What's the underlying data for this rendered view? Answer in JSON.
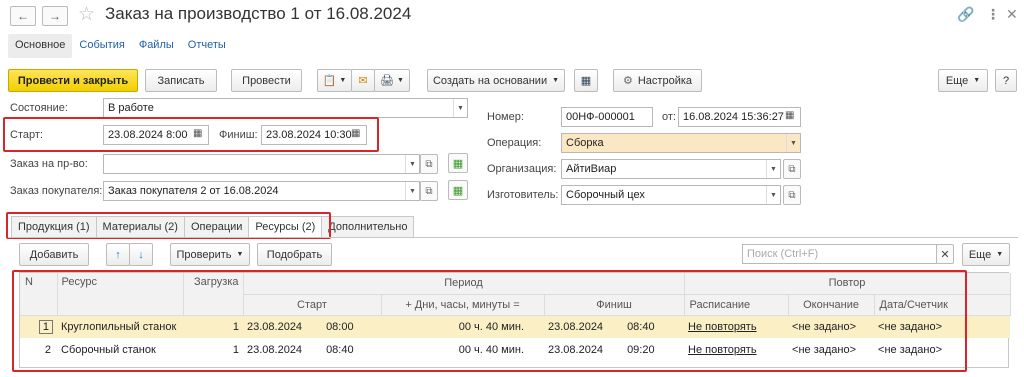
{
  "window": {
    "title": "Заказ на производство 1 от 16.08.2024"
  },
  "nav_tabs": [
    "Основное",
    "События",
    "Файлы",
    "Отчеты"
  ],
  "toolbar": {
    "post_close": "Провести и закрыть",
    "save": "Записать",
    "post": "Провести",
    "create_based": "Создать на основании",
    "settings": "Настройка",
    "more": "Еще",
    "help": "?"
  },
  "form": {
    "state_label": "Состояние:",
    "state_value": "В работе",
    "start_label": "Старт:",
    "start_value": "23.08.2024  8:00",
    "finish_label": "Финиш:",
    "finish_value": "23.08.2024 10:30",
    "prod_order_label": "Заказ на пр-во:",
    "prod_order_value": "",
    "customer_order_label": "Заказ покупателя:",
    "customer_order_value": "Заказ покупателя 2 от 16.08.2024",
    "number_label": "Номер:",
    "number_value": "00НФ-000001",
    "from_label": "от:",
    "from_value": "16.08.2024 15:36:27",
    "operation_label": "Операция:",
    "operation_value": "Сборка",
    "org_label": "Организация:",
    "org_value": "АйтиВиар",
    "maker_label": "Изготовитель:",
    "maker_value": "Сборочный цех"
  },
  "doc_tabs": [
    "Продукция (1)",
    "Материалы (2)",
    "Операции",
    "Ресурсы (2)",
    "Дополнительно"
  ],
  "table_toolbar": {
    "add": "Добавить",
    "check": "Проверить",
    "pick": "Подобрать",
    "search_placeholder": "Поиск (Ctrl+F)",
    "more": "Еще"
  },
  "grid": {
    "headers": {
      "n": "N",
      "resource": "Ресурс",
      "load": "Загрузка",
      "period": "Период",
      "repeat": "Повтор",
      "start": "Старт",
      "plus": "+ Дни, часы, минуты =",
      "finish": "Финиш",
      "schedule": "Расписание",
      "end": "Окончание",
      "date_counter": "Дата/Счетчик"
    },
    "rows": [
      {
        "n": "1",
        "resource": "Круглопильный станок",
        "load": "1",
        "start_date": "23.08.2024",
        "start_time": "08:00",
        "duration": "00 ч. 40 мин.",
        "finish_date": "23.08.2024",
        "finish_time": "08:40",
        "schedule": "Не повторять",
        "end": "<не задано>",
        "date_counter": "<не задано>"
      },
      {
        "n": "2",
        "resource": "Сборочный станок",
        "load": "1",
        "start_date": "23.08.2024",
        "start_time": "08:40",
        "duration": "00 ч. 40 мин.",
        "finish_date": "23.08.2024",
        "finish_time": "09:20",
        "schedule": "Не повторять",
        "end": "<не задано>",
        "date_counter": "<не задано>"
      }
    ]
  }
}
